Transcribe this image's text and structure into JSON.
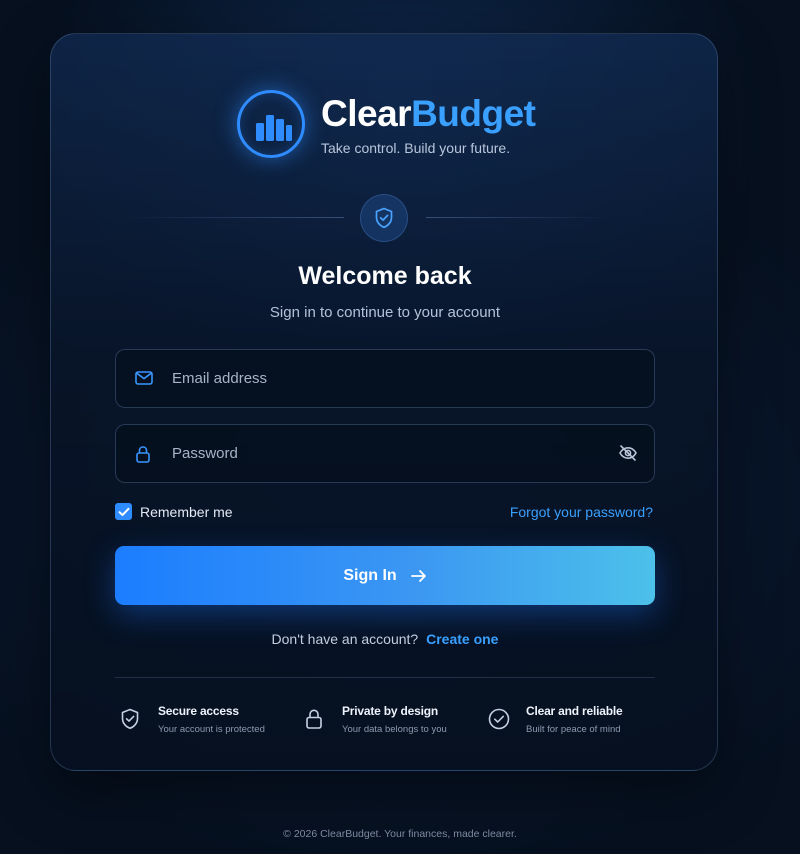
{
  "brand": {
    "name_part1": "Clear",
    "name_part2": "Budget",
    "tagline": "Take control. Build your future."
  },
  "login": {
    "title": "Welcome back",
    "subtitle": "Sign in to continue to your account",
    "email_placeholder": "Email address",
    "password_placeholder": "Password",
    "remember_label": "Remember me",
    "remember_checked": true,
    "forgot_label": "Forgot your password?",
    "signin_label": "Sign In",
    "signup_prompt": "Don't have an account?",
    "signup_link": "Create one"
  },
  "features": [
    {
      "icon": "shield-check-icon",
      "title": "Secure access",
      "subtitle": "Your account is protected"
    },
    {
      "icon": "lock-icon",
      "title": "Private by design",
      "subtitle": "Your data belongs to you"
    },
    {
      "icon": "check-circle-icon",
      "title": "Clear and reliable",
      "subtitle": "Built for peace of mind"
    }
  ],
  "footer": "© 2026 ClearBudget. Your finances, made clearer.",
  "colors": {
    "accent": "#2f8cff",
    "link": "#3aa0ff",
    "background": "#06101f"
  }
}
